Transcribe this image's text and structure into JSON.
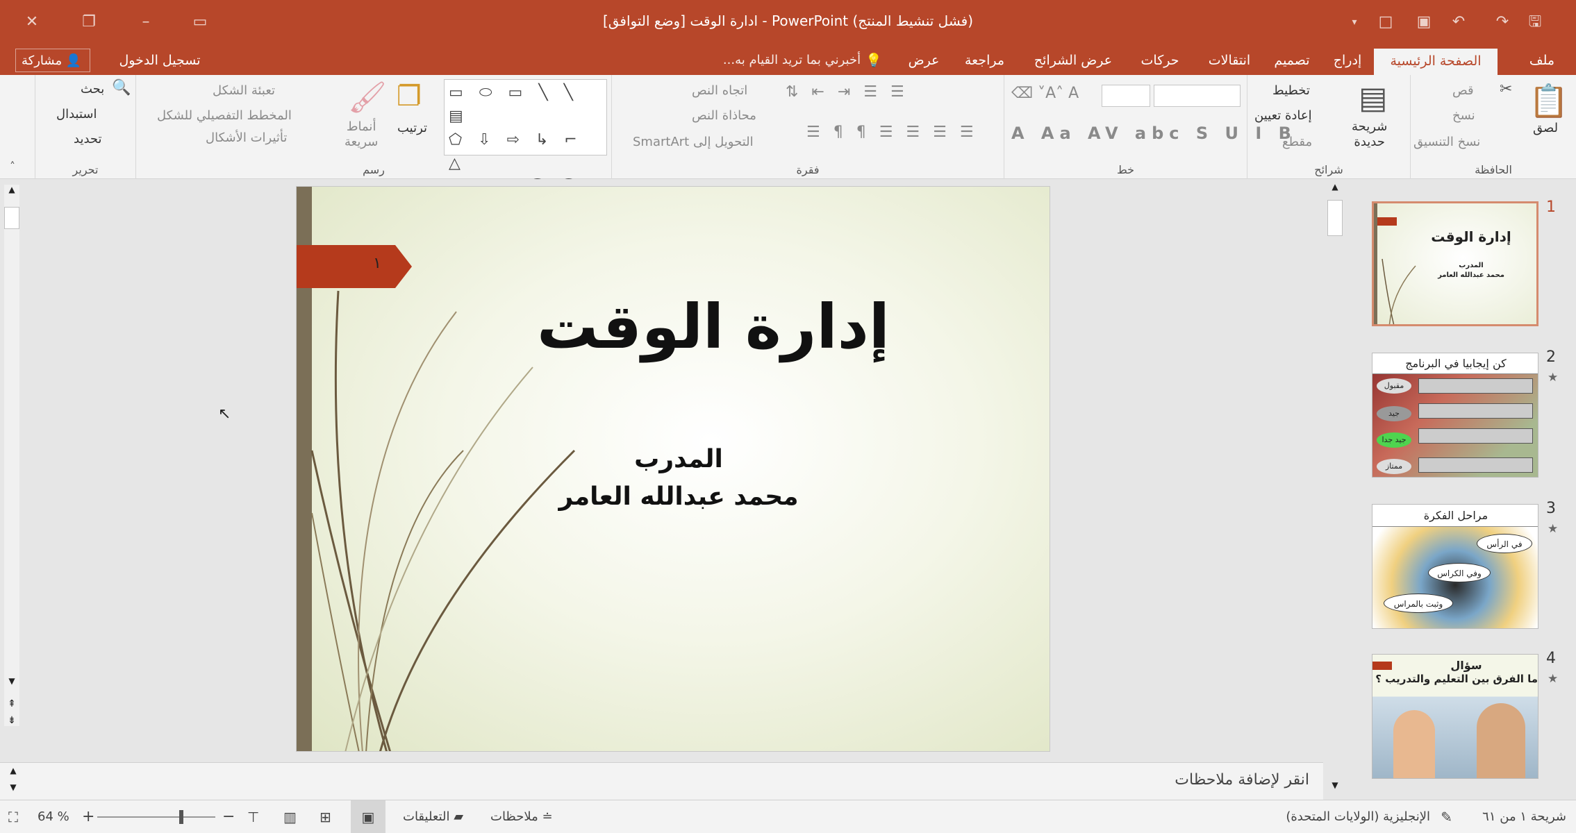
{
  "window": {
    "title": "ادارة الوقت [وضع التوافق] - PowerPoint (فشل تنشيط المنتج)"
  },
  "tabs": {
    "file": "ملف",
    "home": "الصفحة الرئيسية",
    "insert": "إدراج",
    "design": "تصميم",
    "transitions": "انتقالات",
    "animations": "حركات",
    "slideshow": "عرض الشرائح",
    "review": "مراجعة",
    "view": "عرض",
    "tellme": "أخبرني بما تريد القيام به...",
    "signin": "تسجيل الدخول",
    "share": "مشاركة"
  },
  "ribbon": {
    "clipboard": {
      "label": "الحافظة",
      "paste": "لصق",
      "cut": "قص",
      "copy": "نسخ",
      "format_painter": "نسخ التنسيق"
    },
    "slides": {
      "label": "شرائح",
      "new_slide": "شريحة\nحديدة",
      "layout": "تخطيط",
      "reset": "إعادة تعيين",
      "section": "مقطع"
    },
    "font": {
      "label": "خط"
    },
    "paragraph": {
      "label": "فقرة",
      "text_direction": "اتجاه النص",
      "align_text": "محاذاة النص",
      "smartart": "التحويل إلى SmartArt"
    },
    "drawing": {
      "label": "رسم",
      "arrange": "ترتيب",
      "quick_styles": "أنماط\nسريعة",
      "shape_fill": "تعبئة الشكل",
      "shape_outline": "المخطط التفصيلي للشكل",
      "shape_effects": "تأثيرات الأشكال"
    },
    "editing": {
      "label": "تحرير",
      "find": "بحث",
      "replace": "استبدال",
      "select": "تحديد"
    }
  },
  "slide": {
    "number": "١",
    "title": "إدارة الوقت",
    "subtitle1": "المدرب",
    "subtitle2": "محمد عبدالله العامر"
  },
  "thumbnails": [
    {
      "num": "1",
      "title": "إدارة الوقت",
      "sub1": "المدرب",
      "sub2": "محمد عبدالله العامر"
    },
    {
      "num": "2",
      "title": "كن إيجابيا في البرنامج",
      "tags": [
        "مقبول",
        "جيد",
        "جيد جدا",
        "ممتاز"
      ]
    },
    {
      "num": "3",
      "title": "مراحل الفكرة",
      "bubbles": [
        "في الرأس",
        "وفي الكراس",
        "وثبت بالمراس"
      ]
    },
    {
      "num": "4",
      "title": "سؤال",
      "subtitle": "ما الفرق بين التعليم والتدريب ؟"
    }
  ],
  "notes": {
    "placeholder": "انقر لإضافة ملاحظات"
  },
  "status": {
    "slide_info": "شريحة ١ من ٦١",
    "language": "الإنجليزية (الولايات المتحدة)",
    "notes": "ملاحظات",
    "comments": "التعليقات",
    "zoom": "64 %"
  },
  "colors": {
    "accent": "#b7472a",
    "slide_banner": "#b53a1c",
    "slide_bar": "#7b6f57"
  }
}
